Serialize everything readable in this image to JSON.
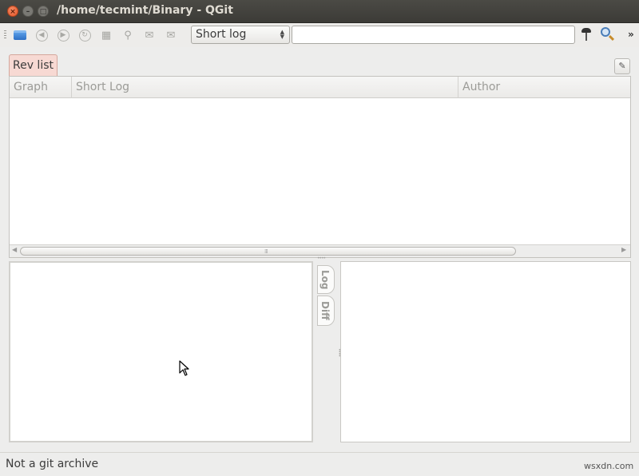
{
  "window": {
    "title": "/home/tecmint/Binary - QGit",
    "close_glyph": "×",
    "min_glyph": "–",
    "max_glyph": "□"
  },
  "toolbar": {
    "icons": [
      "open-folder-icon",
      "back-icon",
      "forward-icon",
      "refresh-icon",
      "view-icon",
      "tag-icon",
      "patch-icon",
      "apply-patch-icon"
    ],
    "log_combo": {
      "selected": "Short log",
      "arrows": "▲▼"
    },
    "search": {
      "value": "",
      "placeholder": ""
    },
    "overflow_label": "»"
  },
  "tabs": {
    "rev_list": "Rev list"
  },
  "rev_list": {
    "columns": [
      "Graph",
      "Short Log",
      "Author"
    ],
    "rows": [],
    "scroll_grip": "⁞⁞⁞",
    "scroll_left": "◀",
    "scroll_right": "▶"
  },
  "side_tabs": {
    "log": "Log",
    "diff": "Diff"
  },
  "status": {
    "message": "Not a git archive"
  },
  "watermark": "wsxdn.com",
  "colors": {
    "active_tab_bg": "#f7d9d3",
    "titlebar_bg": "#3c3b37",
    "close_button": "#e3562a"
  }
}
